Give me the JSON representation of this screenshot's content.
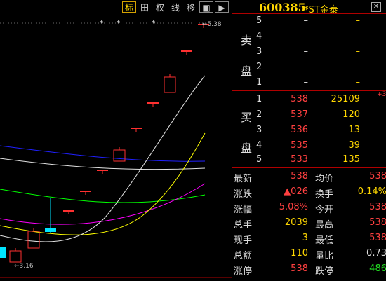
{
  "toolbar": {
    "active": "标",
    "items": [
      "标",
      "田",
      "权",
      "线",
      "移",
      "▣",
      "▶"
    ]
  },
  "chart": {
    "max_label": "←5.38",
    "min_label": "←3.16",
    "star_glyph": "*",
    "colors": {
      "background": "#000000",
      "up_candle": "#ff3030",
      "down_candle": "#00e5ff",
      "ma_white": "#e0e0e0",
      "ma_yellow": "#ffff00",
      "ma_magenta": "#ff00ff",
      "ma_green": "#00ff00",
      "ma_blue": "#2020ff"
    }
  },
  "quote": {
    "code": "600385",
    "name": "*ST金泰",
    "sell_side_label": [
      "卖",
      "盘"
    ],
    "buy_side_label": [
      "买",
      "盘"
    ],
    "sell": [
      {
        "level": "5",
        "price": "–",
        "volume": "–"
      },
      {
        "level": "4",
        "price": "–",
        "volume": "–"
      },
      {
        "level": "3",
        "price": "–",
        "volume": "–"
      },
      {
        "level": "2",
        "price": "–",
        "volume": "–"
      },
      {
        "level": "1",
        "price": "–",
        "volume": "–"
      }
    ],
    "buy": [
      {
        "level": "1",
        "price": "538",
        "volume": "25109"
      },
      {
        "level": "2",
        "price": "537",
        "volume": "120"
      },
      {
        "level": "3",
        "price": "536",
        "volume": "13"
      },
      {
        "level": "4",
        "price": "535",
        "volume": "39"
      },
      {
        "level": "5",
        "price": "533",
        "volume": "135"
      }
    ],
    "buy1_change": "+3",
    "stats": [
      {
        "l1": "最新",
        "v1": "538",
        "l2": "均价",
        "v2": "538"
      },
      {
        "l1": "涨跌",
        "v1": "▲026",
        "l2": "换手",
        "v2": "0.14%"
      },
      {
        "l1": "涨幅",
        "v1": "5.08%",
        "l2": "今开",
        "v2": "538"
      },
      {
        "l1": "总手",
        "v1": "2039",
        "l2": "最高",
        "v2": "538"
      },
      {
        "l1": "现手",
        "v1": "3",
        "l2": "最低",
        "v2": "538"
      },
      {
        "l1": "总额",
        "v1": "110",
        "l2": "量比",
        "v2": "0.73"
      },
      {
        "l1": "涨停",
        "v1": "538",
        "l2": "跌停",
        "v2": "486"
      }
    ]
  }
}
